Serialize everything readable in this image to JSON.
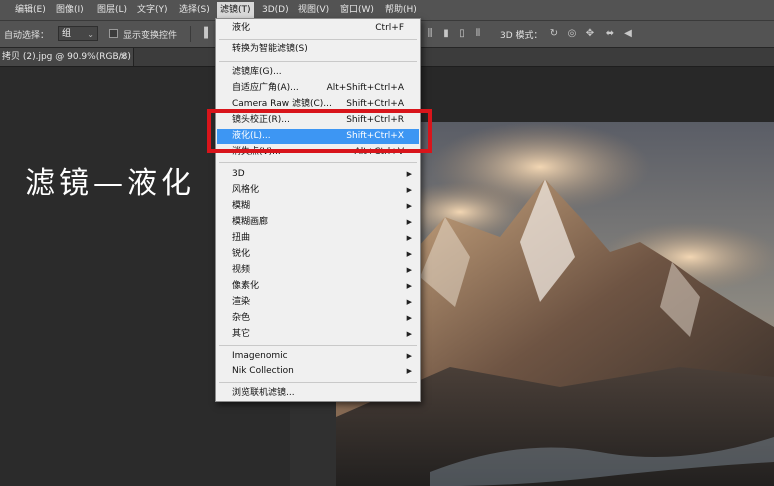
{
  "menubar": {
    "items": [
      "编辑(E)",
      "图像(I)",
      "图层(L)",
      "文字(Y)",
      "选择(S)",
      "滤镜(T)",
      "3D(D)",
      "视图(V)",
      "窗口(W)",
      "帮助(H)"
    ]
  },
  "options": {
    "auto_select_label": "自动选择：",
    "auto_select_value": "组",
    "transform_label": "显示变换控件",
    "mode_3d_label": "3D 模式："
  },
  "document_tab": {
    "title": "拷贝 (2).jpg @ 90.9%(RGB/8)",
    "close": "×"
  },
  "overlay": {
    "title": "滤镜—液化"
  },
  "filter_menu": {
    "items": [
      {
        "label": "液化",
        "shortcut": "Ctrl+F"
      },
      {
        "label": "转换为智能滤镜(S)",
        "shortcut": ""
      },
      {
        "label": "滤镜库(G)...",
        "shortcut": ""
      },
      {
        "label": "自适应广角(A)...",
        "shortcut": "Alt+Shift+Ctrl+A"
      },
      {
        "label": "Camera Raw 滤镜(C)...",
        "shortcut": "Shift+Ctrl+A"
      },
      {
        "label": "镜头校正(R)...",
        "shortcut": "Shift+Ctrl+R"
      },
      {
        "label": "液化(L)...",
        "shortcut": "Shift+Ctrl+X"
      },
      {
        "label": "消失点(V)...",
        "shortcut": "Alt+Ctrl+V"
      }
    ],
    "submenus": [
      "3D",
      "风格化",
      "模糊",
      "模糊画廊",
      "扭曲",
      "锐化",
      "视频",
      "像素化",
      "渲染",
      "杂色",
      "其它"
    ],
    "plugins": [
      "Imagenomic",
      "Nik Collection"
    ],
    "browse": "浏览联机滤镜..."
  },
  "colors": {
    "highlight": "#3d96f3",
    "annotation_box": "#d8151b"
  }
}
